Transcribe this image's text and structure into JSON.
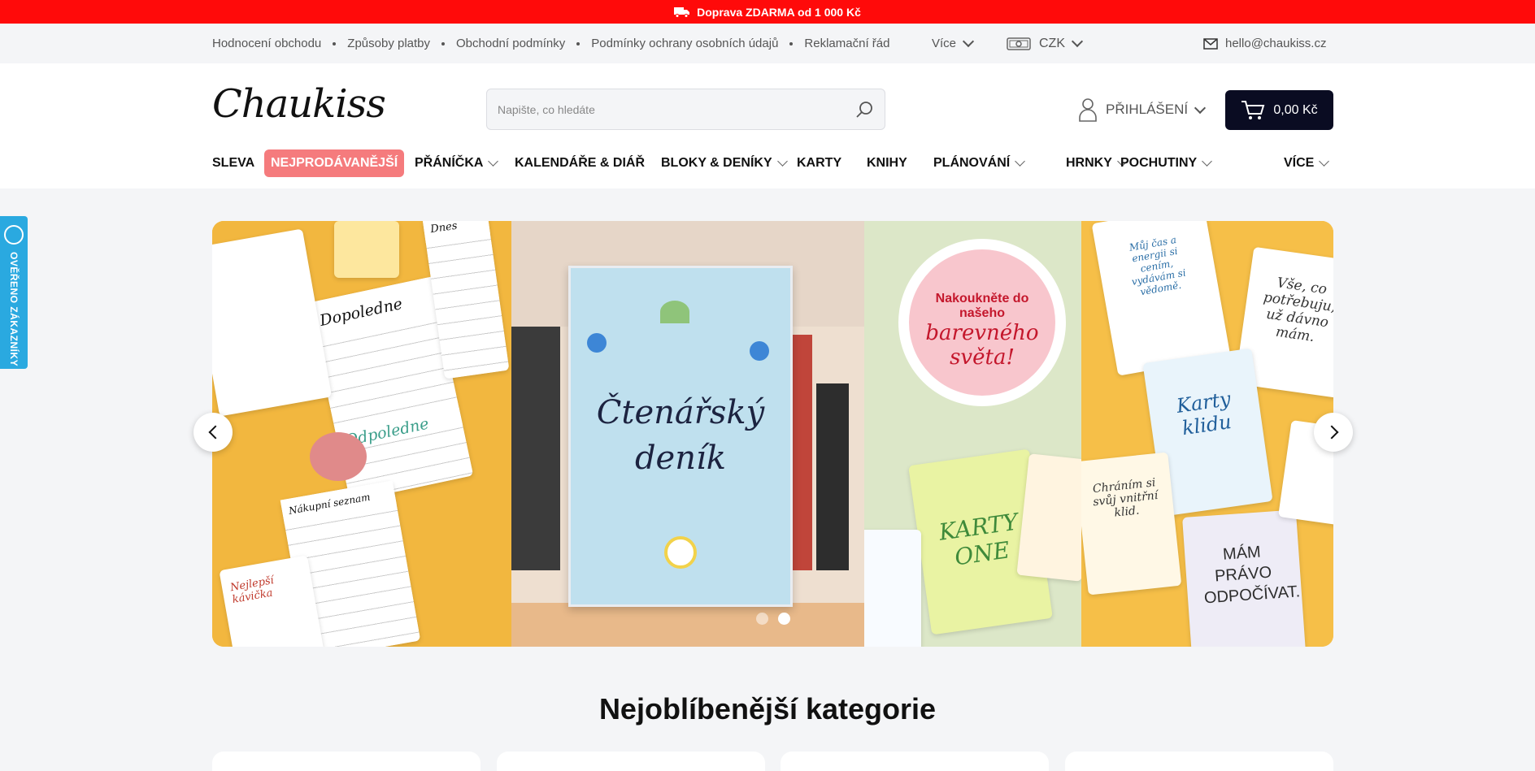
{
  "promo": {
    "text": "Doprava ZDARMA od 1 000 Kč",
    "icon": "truck-icon",
    "color": "#ff0a0a"
  },
  "util_links": [
    {
      "label": "Hodnocení obchodu"
    },
    {
      "label": "Způsoby platby"
    },
    {
      "label": "Obchodní podmínky"
    },
    {
      "label": "Podmínky ochrany osobních údajů"
    },
    {
      "label": "Reklamační řád"
    }
  ],
  "util_more": "Více",
  "currency": {
    "code": "CZK",
    "icon": "money-icon"
  },
  "email": {
    "address": "hello@chaukiss.cz",
    "icon": "mail-icon"
  },
  "logo": "Chaukiss",
  "search": {
    "placeholder": "Napište, co hledáte",
    "icon": "search-icon"
  },
  "login": {
    "label": "PŘIHLÁŠENÍ",
    "icon": "user-icon"
  },
  "cart": {
    "amount": "0,00 Kč",
    "icon": "cart-icon",
    "color": "#0a0c22"
  },
  "nav": [
    {
      "label": "SLEVA",
      "dropdown": false
    },
    {
      "label": "NEJPRODÁVANĚJŠÍ",
      "dropdown": false,
      "highlight": "#f57b7d"
    },
    {
      "label": "PŘÁNÍČKA",
      "dropdown": true
    },
    {
      "label": "KALENDÁŘE & DIÁŘ",
      "dropdown": false
    },
    {
      "label": "BLOKY & DENÍKY",
      "dropdown": true
    },
    {
      "label": "KARTY",
      "dropdown": false
    },
    {
      "label": "KNIHY",
      "dropdown": false
    },
    {
      "label": "PLÁNOVÁNÍ",
      "dropdown": true
    },
    {
      "label": "HRNKY",
      "dropdown": true
    },
    {
      "label": "POCHUTINY",
      "dropdown": true
    },
    {
      "label": "VÍCE",
      "dropdown": true
    }
  ],
  "verified_tab": {
    "label": "OVĚŘENO ZÁKAZNÍKY",
    "color": "#2aa9e0"
  },
  "banner": {
    "notepads": [
      "Dopoledne",
      "Odpoledne",
      "Nákupní seznam",
      "Dnes",
      "Nejlepší kávička"
    ],
    "book_title": [
      "Čtenářský",
      "deník"
    ],
    "badge": [
      "Nakoukněte do",
      "našeho",
      "barevného",
      "světa!"
    ],
    "cards": [
      "Karty klidu",
      "KARTY ONE",
      "MÁM PRÁVO ODPOČÍVAT.",
      "Vše, co potřebuju, už dávno mám.",
      "Chráním si svůj vnitřní klid.",
      "Můj čas a energii si cením, vydávám si vědomě."
    ],
    "slides": 2,
    "active_slide": 2
  },
  "section_title": "Nejoblíbenější kategorie"
}
